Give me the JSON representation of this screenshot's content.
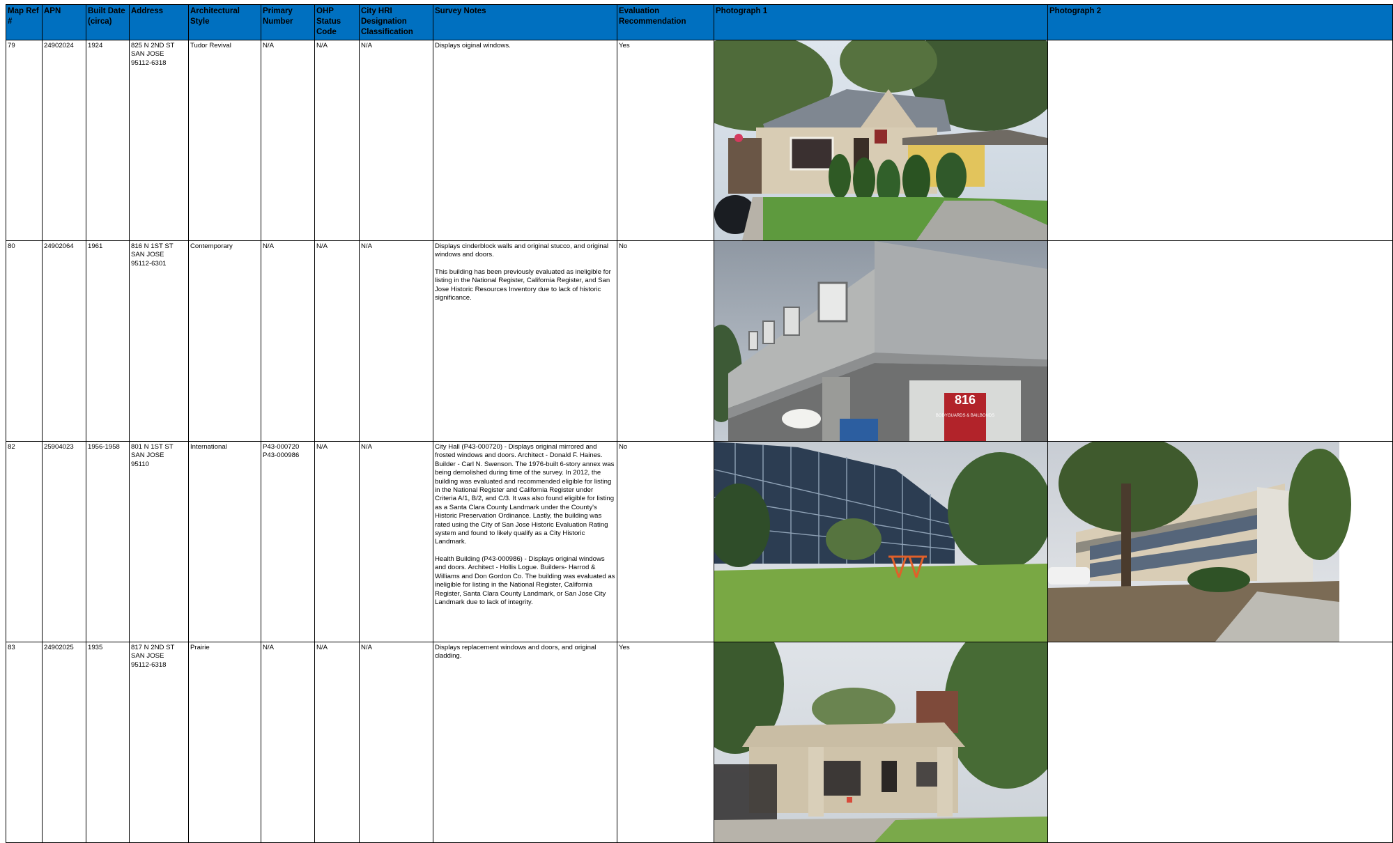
{
  "colors": {
    "header_bg": "#0070c0",
    "border": "#000000"
  },
  "headers": {
    "map_ref": "Map Ref #",
    "apn": "APN",
    "built": "Built Date (circa)",
    "address": "Address",
    "style": "Architectural Style",
    "primary": "Primary Number",
    "ohp": "OHP Status Code",
    "hri": "City HRI Designation Classification",
    "notes": "Survey Notes",
    "eval": "Evaluation Recommendation",
    "photo1": "Photograph 1",
    "photo2": "Photograph 2"
  },
  "rows": [
    {
      "map_ref": "79",
      "apn": "24902024",
      "built": "1924",
      "address": [
        "825 N 2ND ST",
        "SAN JOSE",
        "95112-6318"
      ],
      "style": "Tudor Revival",
      "primary": [
        "N/A"
      ],
      "ohp": "N/A",
      "hri": "N/A",
      "notes": [
        "Displays oiginal windows."
      ],
      "eval": "Yes",
      "photo1": "tudor-revival-house-photo",
      "photo2": ""
    },
    {
      "map_ref": "80",
      "apn": "24902064",
      "built": "1961",
      "address": [
        "816 N 1ST ST",
        "SAN JOSE",
        "95112-6301"
      ],
      "style": "Contemporary",
      "primary": [
        "N/A"
      ],
      "ohp": "N/A",
      "hri": "N/A",
      "notes": [
        "Displays cinderblock walls and original stucco, and original windows and doors.",
        "This building has been previously evaluated as ineligible for listing in the National Register, California Register, and San Jose Historic Resources Inventory due to lack of historic significance."
      ],
      "eval": "No",
      "photo1": "contemporary-apartment-photo",
      "photo2": "",
      "sign_number": "816",
      "sign_text": "BODYGUARDS & BAILBONDS"
    },
    {
      "map_ref": "82",
      "apn": "25904023",
      "built": "1956-1958",
      "address": [
        "801  N 1ST ST",
        "SAN JOSE",
        "95110"
      ],
      "style": "International",
      "primary": [
        "P43-000720",
        "P43-000986"
      ],
      "ohp": "N/A",
      "hri": "N/A",
      "notes": [
        "City Hall (P43-000720) - Displays original mirrored and frosted windows and doors. Architect - Donald F. Haines. Builder - Carl N. Swenson. The 1976-built 6-story annex was being demolished during time of the survey. In 2012, the building was evaluated and recommended eligible for listing in the National Register and California Register under Criteria A/1, B/2, and C/3. It was also found eligible for listing as a Santa Clara County Landmark under the County's Historic Preservation Ordinance. Lastly, the building was rated using the City of San Jose Historic Evaluation Rating system and found to likely qualify as a City Historic Landmark.",
        "Health Building (P43-000986) - Displays original windows and doors. Architect - Hollis Logue. Builders- Harrod & Williams and Don Gordon Co. The building was evaluated as ineligible for listing in the National Register, California Register, Santa Clara County Landmark, or San Jose City Landmark due to lack of integrity."
      ],
      "eval": "No",
      "photo1": "city-hall-curved-glass-building-photo",
      "photo2": "health-building-photo"
    },
    {
      "map_ref": "83",
      "apn": "24902025",
      "built": "1935",
      "address": [
        "817 N 2ND ST",
        "SAN JOSE",
        "95112-6318"
      ],
      "style": "Prairie",
      "primary": [
        "N/A"
      ],
      "ohp": "N/A",
      "hri": "N/A",
      "notes": [
        "Displays replacement windows and doors, and original cladding."
      ],
      "eval": "Yes",
      "photo1": "prairie-house-photo",
      "photo2": ""
    }
  ]
}
